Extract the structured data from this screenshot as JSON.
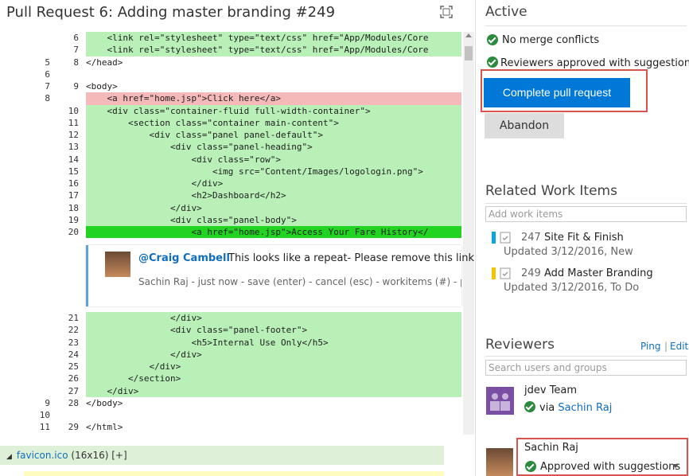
{
  "header": {
    "title": "Pull Request 6: Adding master branding #249"
  },
  "code_lines": [
    {
      "old": "",
      "new": "6",
      "text": "    <link rel=\"stylesheet\" type=\"text/css\" href=\"App/Modules/Core",
      "kind": "add"
    },
    {
      "old": "",
      "new": "7",
      "text": "    <link rel=\"stylesheet\" type=\"text/css\" href=\"App/Modules/Core",
      "kind": "add"
    },
    {
      "old": "5",
      "new": "8",
      "text": "</head>",
      "kind": "ctx"
    },
    {
      "old": "6",
      "new": "",
      "text": "",
      "kind": "del"
    },
    {
      "old": "7",
      "new": "9",
      "text": "<body>",
      "kind": "ctx"
    },
    {
      "old": "8",
      "new": "",
      "text": "    <a href=\"home.jsp\">Click here</a>",
      "kind": "del"
    },
    {
      "old": "",
      "new": "10",
      "text": "    <div class=\"container-fluid full-width-container\">",
      "kind": "add"
    },
    {
      "old": "",
      "new": "11",
      "text": "        <section class=\"container main-content\">",
      "kind": "add"
    },
    {
      "old": "",
      "new": "12",
      "text": "            <div class=\"panel panel-default\">",
      "kind": "add"
    },
    {
      "old": "",
      "new": "13",
      "text": "                <div class=\"panel-heading\">",
      "kind": "add"
    },
    {
      "old": "",
      "new": "14",
      "text": "                    <div class=\"row\">",
      "kind": "add"
    },
    {
      "old": "",
      "new": "15",
      "text": "                        <img src=\"Content/Images/logologin.png\">",
      "kind": "add"
    },
    {
      "old": "",
      "new": "16",
      "text": "                    </div>",
      "kind": "add"
    },
    {
      "old": "",
      "new": "17",
      "text": "                    <h2>Dashboard</h2>",
      "kind": "add"
    },
    {
      "old": "",
      "new": "18",
      "text": "                </div>",
      "kind": "add"
    },
    {
      "old": "",
      "new": "19",
      "text": "                <div class=\"panel-body\">",
      "kind": "add"
    },
    {
      "old": "",
      "new": "20",
      "text": "                    <a href=\"home.jsp\">Access Your Fare History</",
      "kind": "hl"
    }
  ],
  "code_lines_after": [
    {
      "old": "",
      "new": "21",
      "text": "                </div>",
      "kind": "add"
    },
    {
      "old": "",
      "new": "22",
      "text": "                <div class=\"panel-footer\">",
      "kind": "add"
    },
    {
      "old": "",
      "new": "23",
      "text": "                    <h5>Internal Use Only</h5>",
      "kind": "add"
    },
    {
      "old": "",
      "new": "24",
      "text": "                </div>",
      "kind": "add"
    },
    {
      "old": "",
      "new": "25",
      "text": "            </div>",
      "kind": "add"
    },
    {
      "old": "",
      "new": "26",
      "text": "        </section>",
      "kind": "add"
    },
    {
      "old": "",
      "new": "27",
      "text": "    </div>",
      "kind": "add"
    },
    {
      "old": "9",
      "new": "28",
      "text": "</body>",
      "kind": "ctx"
    },
    {
      "old": "10",
      "new": "",
      "text": "",
      "kind": "del"
    },
    {
      "old": "11",
      "new": "29",
      "text": "</html>",
      "kind": "ctx"
    }
  ],
  "comment": {
    "author": "@Craig Cambell",
    "text": "This looks like a repeat- Please remove this link",
    "meta": "Sachin Raj - just now - save (enter) - cancel (esc) - workitems (#) - peo"
  },
  "file_row": {
    "name": "favicon.ico",
    "rest": " (16x16) [+]"
  },
  "status": {
    "heading": "Active",
    "checks": [
      "No merge conflicts",
      "Reviewers approved with suggestions"
    ],
    "complete_label": "Complete pull request",
    "abandon_label": "Abandon"
  },
  "work_items": {
    "heading": "Related Work Items",
    "placeholder": "Add work items",
    "items": [
      {
        "id": "247",
        "title": "Site Fit & Finish",
        "sub": "Updated 3/12/2016, New",
        "color": "#0ea5d8"
      },
      {
        "id": "249",
        "title": "Add Master Branding",
        "sub": "Updated 3/12/2016, To Do",
        "color": "#f5c400"
      }
    ]
  },
  "reviewers": {
    "heading": "Reviewers",
    "ping": "Ping",
    "edit": "Edit",
    "placeholder": "Search users and groups",
    "team": {
      "name": "jdev Team",
      "via": "via",
      "via_name": "Sachin Raj"
    },
    "person": {
      "name": "Sachin Raj",
      "status": "Approved with suggestions"
    }
  },
  "colors": {
    "accent": "#0078d7",
    "added": "#b8f0b8",
    "removed": "#f6b9b9",
    "highlight": "#22d322",
    "approved": "#2b8a3e"
  }
}
